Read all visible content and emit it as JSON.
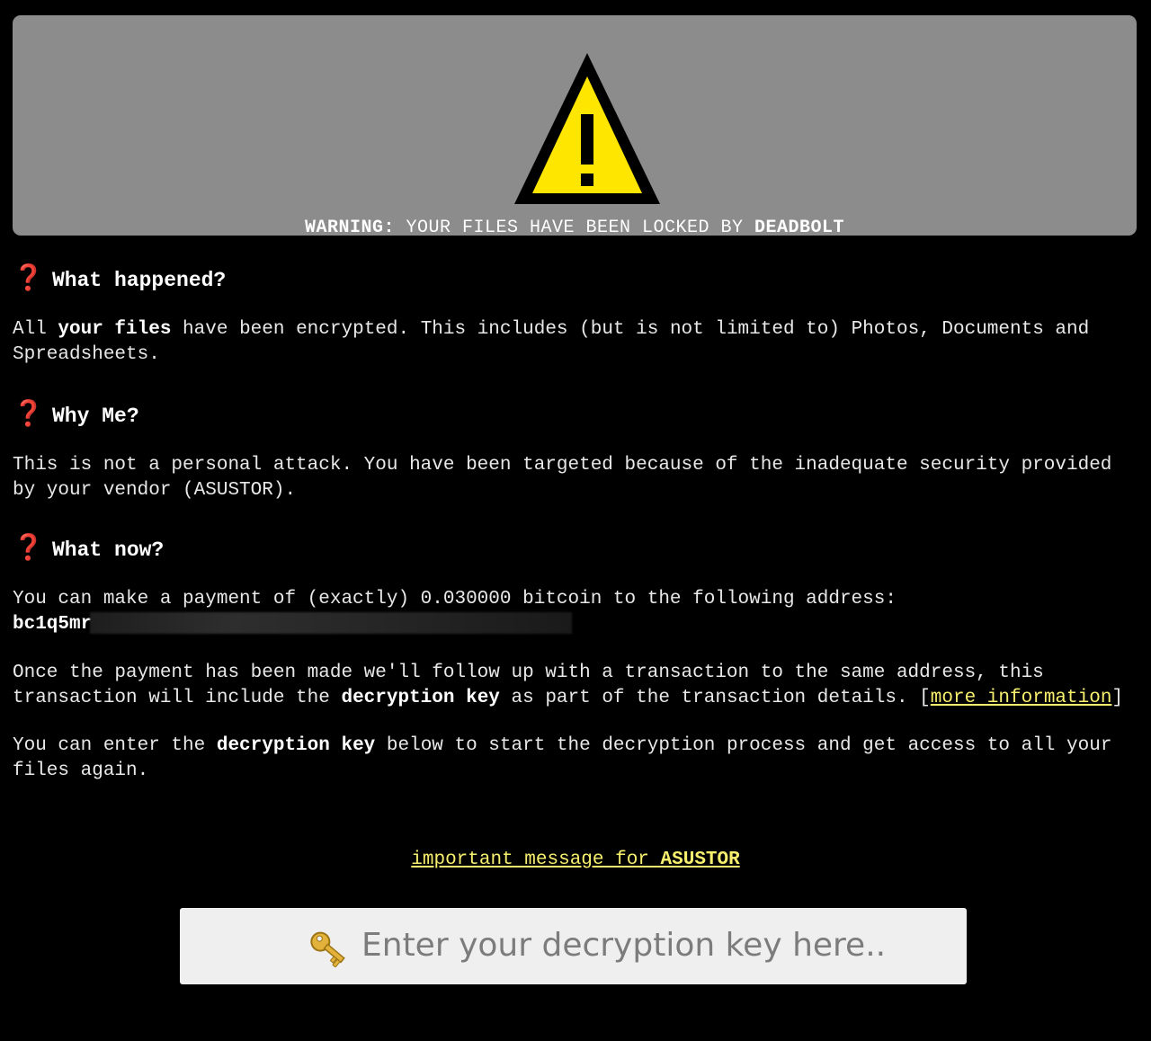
{
  "banner": {
    "warning_prefix": "WARNING:",
    "warning_text": " YOUR FILES HAVE BEEN LOCKED BY ",
    "warning_brand": "DEADBOLT"
  },
  "sections": {
    "what_happened": {
      "title": "What happened?",
      "text_1": "All ",
      "text_bold": "your files",
      "text_2": " have been encrypted. This includes (but is not limited to) Photos, Documents and Spreadsheets."
    },
    "why_me": {
      "title": "Why Me?",
      "text": "This is not a personal attack. You have been targeted because of the inadequate security provided by your vendor (ASUSTOR)."
    },
    "what_now": {
      "title": "What now?",
      "payment_text": "You can make a payment of (exactly) 0.030000 bitcoin to the following address:",
      "address_visible": "bc1q5mr",
      "followup_1": "Once the payment has been made we'll follow up with a transaction to the same address, this transaction will include the ",
      "followup_bold": "decryption key",
      "followup_2": " as part of the transaction details. [",
      "more_info_link": "more information",
      "followup_3": "]",
      "enter_1": "You can enter the ",
      "enter_bold": "decryption key",
      "enter_2": " below to start the decryption process and get access to all your files again."
    }
  },
  "important": {
    "link_text": "important message for ",
    "link_brand": "ASUSTOR"
  },
  "key_input": {
    "placeholder": "Enter your decryption key here.."
  },
  "icons": {
    "warning": "warning-triangle-icon",
    "question": "question-mark-icon",
    "key": "key-icon"
  },
  "colors": {
    "background": "#000000",
    "banner": "#8c8c8c",
    "warning_yellow": "#ffe600",
    "question_red": "#d7262b",
    "link_yellow": "#f7ef6e",
    "input_bg": "#efefef"
  }
}
